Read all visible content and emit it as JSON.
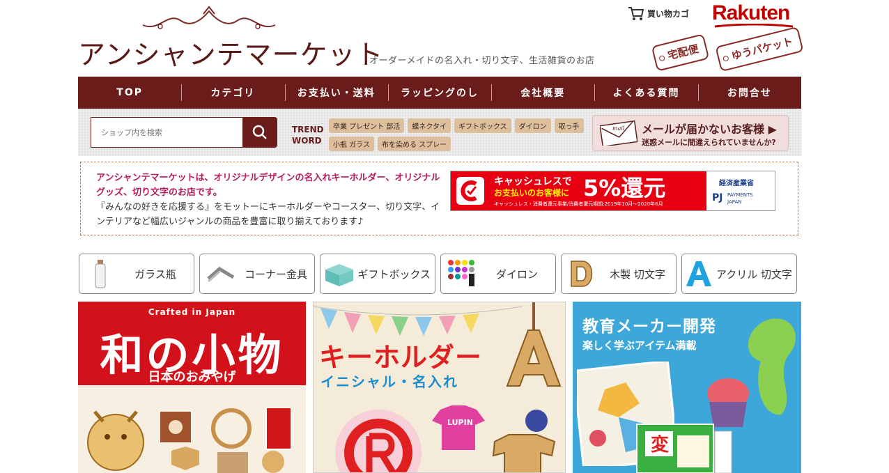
{
  "header": {
    "logo": "アンシャンテマーケット",
    "tagline": "オーダーメイドの名入れ・切り文字、生活雑貨のお店",
    "cart_label": "買い物カゴ",
    "rakuten": "Rakuten",
    "tags": [
      "宅配便",
      "ゆうパケット"
    ]
  },
  "nav": [
    "TOP",
    "カテゴリ",
    "お支払い・送料",
    "ラッピングのし",
    "会社概要",
    "よくある質問",
    "お問合せ"
  ],
  "search": {
    "placeholder": "ショップ内を検索",
    "trend_label_1": "TREND",
    "trend_label_2": "WORD",
    "trend_words": [
      "卒業 プレゼント 部活",
      "蝶ネクタイ",
      "ギフトボックス",
      "ダイロン",
      "取っ手",
      "小瓶 ガラス",
      "布を染める スプレー"
    ]
  },
  "mail_notice": {
    "icon_text": "mail",
    "title": "メールが届かないお客様 ▶",
    "subtitle": "迷惑メールに間違えられていませんか?"
  },
  "info": {
    "highlight": "アンシャンテマーケットは、オリジナルデザインの名入れキーホルダー、オリジナルグッズ、切り文字のお店です。",
    "body": "『みんなの好きを応援する』をモットーにキーホルダーやコースター、切り文字、インテリアなど幅広いジャンルの商品を豊富に取り揃えております♪"
  },
  "cashless": {
    "line1": "キャッシュレスで",
    "line2": "お支払いのお客様に",
    "big": "5%還元",
    "footnote": "キャッシュレス・消費者還元事業/消費者還元期間:2019年10月〜2020年6月",
    "meti": "経済産業省",
    "pj1": "PAYMENTS",
    "pj2": "JAPAN"
  },
  "categories": [
    "ガラス瓶",
    "コーナー金具",
    "ギフトボックス",
    "ダイロン",
    "木製 切文字",
    "アクリル 切文字"
  ],
  "banners": {
    "b1": {
      "top": "Crafted in Japan",
      "title": "和の小物",
      "sub": "日本のおみやげ"
    },
    "b2": {
      "title": "キーホルダー",
      "sub": "イニシャル・名入れ",
      "tshirt": "LUPIN"
    },
    "b3": {
      "title": "教育メーカー開発",
      "sub": "楽しく学ぶアイテム満載",
      "card": "変"
    }
  },
  "colors": {
    "nav": "#6a1c1b",
    "accent": "#b31c5e",
    "rakuten": "#bf0000"
  }
}
